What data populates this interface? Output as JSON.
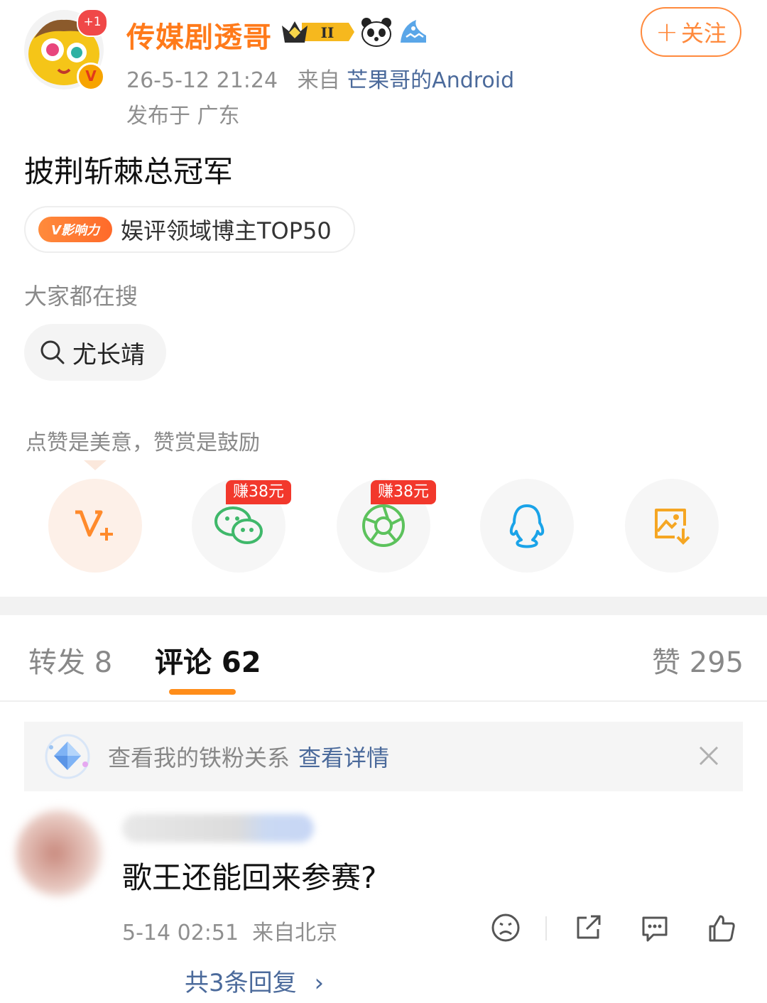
{
  "post": {
    "avatar_badge": "+1",
    "verified_badge": "V",
    "username": "传媒剧透哥",
    "level_badge": "II",
    "follow_plus": "+",
    "follow_label": "关注",
    "time": "26-5-12 21:24",
    "source_prefix": "来自",
    "source": "芒果哥的Android",
    "location": "发布于 广东",
    "text": "披荆斩棘总冠军",
    "influence_badge": "V影响力",
    "influence_text": "娱评领域博主TOP50",
    "hot_search_title": "大家都在搜",
    "hot_search_item": "尤长靖",
    "reward_tip": "点赞是美意，赞赏是鼓励"
  },
  "share": {
    "items": [
      {
        "icon": "reward-v-plus-icon",
        "tag": ""
      },
      {
        "icon": "wechat-icon",
        "tag": "赚38元"
      },
      {
        "icon": "moments-icon",
        "tag": "赚38元"
      },
      {
        "icon": "qq-icon",
        "tag": ""
      },
      {
        "icon": "save-image-icon",
        "tag": ""
      }
    ]
  },
  "tabs": {
    "repost": "转发 8",
    "comment": "评论 62",
    "like": "赞 295"
  },
  "fan_bar": {
    "text": "查看我的铁粉关系",
    "link": "查看详情"
  },
  "comment": {
    "text": "歌王还能回来参赛?",
    "time_loc": "5-14 02:51  来自北京",
    "replies": "共3条回复",
    "reply_arrow": "›"
  },
  "colors": {
    "accent_orange": "#ff7a1a",
    "link_blue": "#4b6a9b",
    "earn_red": "#f2382c",
    "tab_underline": "#ff8d1a"
  }
}
